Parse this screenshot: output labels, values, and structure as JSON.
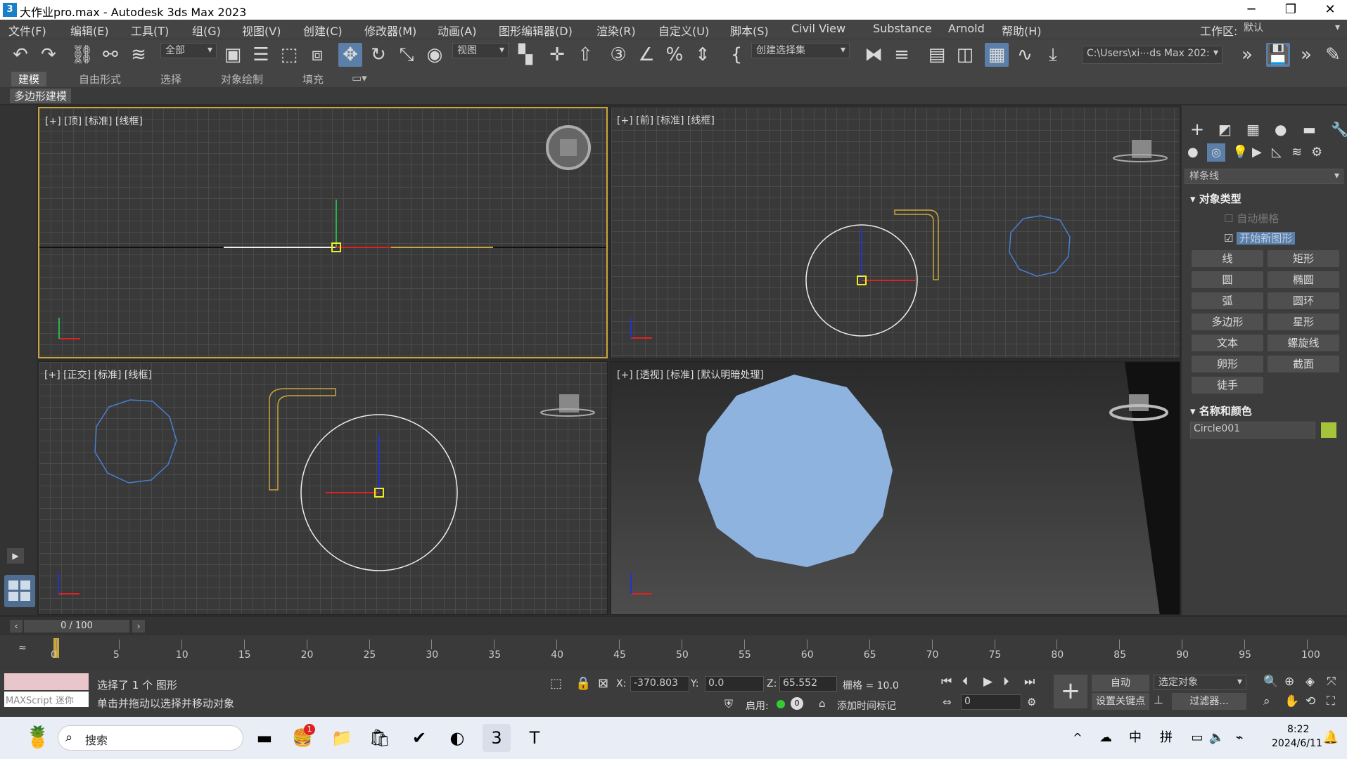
{
  "window": {
    "title": "大作业pro.max - Autodesk 3ds Max 2023",
    "minimize": "─",
    "maximize": "❐",
    "close": "✕"
  },
  "menu": [
    "文件(F)",
    "编辑(E)",
    "工具(T)",
    "组(G)",
    "视图(V)",
    "创建(C)",
    "修改器(M)",
    "动画(A)",
    "图形编辑器(D)",
    "渲染(R)",
    "自定义(U)",
    "脚本(S)",
    "Civil View",
    "Substance",
    "Arnold",
    "帮助(H)"
  ],
  "workspace": {
    "label": "工作区:",
    "value": "默认"
  },
  "toolbar": {
    "filter": "全部",
    "refcoord": "视图",
    "selset": "创建选择集",
    "path": "C:\\Users\\xi⋯ds Max 202:"
  },
  "ribbon": {
    "tabs": [
      "建模",
      "自由形式",
      "选择",
      "对象绘制",
      "填充"
    ],
    "sub": "多边形建模"
  },
  "viewports": {
    "top": "[+] [顶] [标准] [线框]",
    "front": "[+] [前] [标准] [线框]",
    "ortho": "[+] [正交] [标准] [线框]",
    "persp": "[+] [透视] [标准] [默认明暗处理]"
  },
  "cmd": {
    "category": "样条线",
    "section1": "对象类型",
    "autogrid": "自动栅格",
    "startnew": "开始新图形",
    "buttons": [
      "线",
      "矩形",
      "圆",
      "椭圆",
      "弧",
      "圆环",
      "多边形",
      "星形",
      "文本",
      "螺旋线",
      "卵形",
      "截面",
      "徒手"
    ],
    "section2": "名称和颜色",
    "objname": "Circle001",
    "objcolor": "#a6c33a"
  },
  "timeslider": {
    "value": "0 / 100"
  },
  "track": {
    "ticks": [
      0,
      5,
      10,
      15,
      20,
      25,
      30,
      35,
      40,
      45,
      50,
      55,
      60,
      65,
      70,
      75,
      80,
      85,
      90,
      95,
      100
    ]
  },
  "status": {
    "maxscript": "MAXScript 迷你",
    "selected": "选择了 1 个 图形",
    "hint": "单击并拖动以选择并移动对象",
    "x_label": "X:",
    "x": "-370.803",
    "y_label": "Y:",
    "y": "0.0",
    "z_label": "Z:",
    "z": "65.552",
    "grid": "栅格 = 10.0",
    "enable": "启用:",
    "addtime": "添加时间标记",
    "auto": "自动",
    "setkey": "设置关键点",
    "selobj": "选定对象",
    "filters": "过滤器...",
    "frame": "0"
  },
  "taskbar": {
    "search": "搜索",
    "time": "8:22",
    "date": "2024/6/11",
    "ime1": "中",
    "ime2": "拼",
    "badge": "1"
  }
}
